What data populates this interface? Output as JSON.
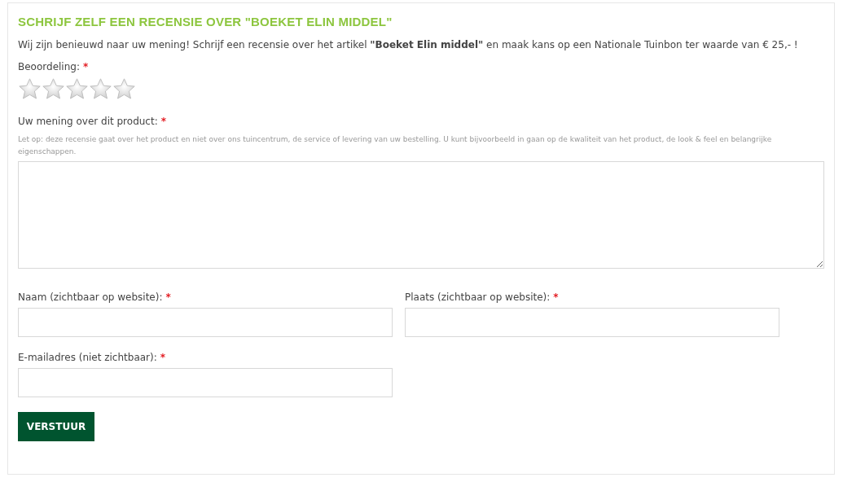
{
  "title": "SCHRIJF ZELF EEN RECENSIE OVER \"BOEKET ELIN MIDDEL\"",
  "intro": "Wij zijn benieuwd naar uw mening! Schrijf een recensie over het artikel **\"Boeket Elin middel\"** en maak kans op een Nationale Tuinbon ter waarde van € 25,- !",
  "rating": {
    "label": "Beoordeling:",
    "required_mark": "*",
    "stars": 0
  },
  "review": {
    "label": "Uw mening over dit product:",
    "required_mark": "*",
    "hint": "Let op: deze recensie gaat over het product en niet over ons tuincentrum, de service of levering van uw bestelling. U kunt bijvoorbeeld in gaan op de kwaliteit van het product, de look & feel en belangrijke eigenschappen."
  },
  "fields": [
    {
      "label": "Naam (zichtbaar op website):",
      "required_mark": "*"
    },
    {
      "label": "Plaats (zichtbaar op website):",
      "required_mark": "*"
    },
    {
      "label": "E-mailadres (niet zichtbaar):",
      "required_mark": "*"
    }
  ],
  "submit": "VERSTUUR"
}
